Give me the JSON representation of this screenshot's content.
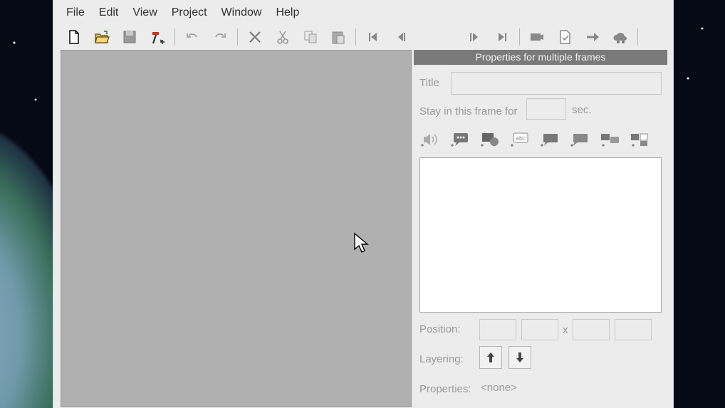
{
  "menu": {
    "items": [
      "File",
      "Edit",
      "View",
      "Project",
      "Window",
      "Help"
    ]
  },
  "toolbar": {
    "icons": [
      "new-file-icon",
      "open-folder-icon",
      "save-icon",
      "build-hammer-icon",
      "undo-icon",
      "redo-icon",
      "delete-x-icon",
      "cut-icon",
      "copy-icon",
      "paste-icon",
      "first-frame-icon",
      "previous-frame-icon",
      "next-frame-icon",
      "last-frame-icon",
      "record-camera-icon",
      "check-document-icon",
      "arrow-right-icon",
      "cloud-export-icon"
    ]
  },
  "panel": {
    "header": "Properties for multiple frames",
    "title_label": "Title",
    "title_value": "",
    "stay_label": "Stay in this frame for",
    "stay_value": "",
    "stay_unit": "sec.",
    "object_icons": [
      "add-sound-icon",
      "add-speech-bubble-icon",
      "add-callout-icon",
      "add-text-icon",
      "add-note-icon",
      "add-comment-icon",
      "add-group-icon",
      "add-layout-icon"
    ],
    "position_label": "Position:",
    "position_separator": "x",
    "position_values": [
      "",
      "",
      "",
      ""
    ],
    "layering_label": "Layering:",
    "properties_label": "Properties:",
    "properties_value": "<none>"
  },
  "colors": {
    "canvas": "#b0b0b0",
    "panel_header": "#7a7a7a",
    "window_bg": "#ececec"
  }
}
